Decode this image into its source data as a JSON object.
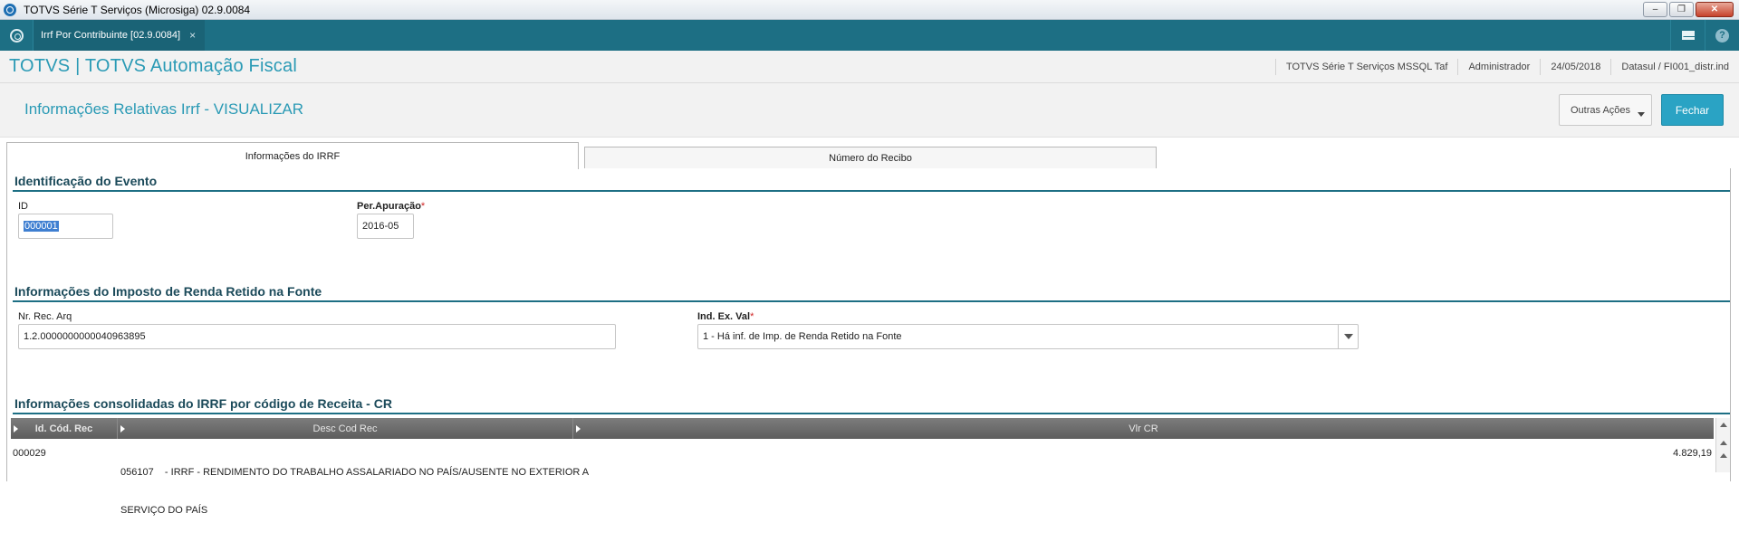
{
  "window": {
    "title": "TOTVS Série T Serviços (Microsiga) 02.9.0084",
    "minimize": "–",
    "restore": "❐",
    "close": "✕"
  },
  "tabbar": {
    "app_tab_label": "Irrf Por Contribuinte [02.9.0084]",
    "app_tab_close": "×",
    "help": "?"
  },
  "header": {
    "brand": "TOTVS | TOTVS Automação Fiscal",
    "info": [
      "TOTVS Série T Serviços MSSQL Taf",
      "Administrador",
      "24/05/2018",
      "Datasul / FI001_distr.ind"
    ]
  },
  "page": {
    "title": "Informações Relativas Irrf - VISUALIZAR",
    "outras_acoes": "Outras Ações",
    "fechar": "Fechar"
  },
  "tabs": [
    {
      "label": "Informações do IRRF",
      "active": true
    },
    {
      "label": "Número do Recibo",
      "active": false
    }
  ],
  "section1": {
    "title": "Identificação do Evento",
    "id_label": "ID",
    "id_value": "000001",
    "per_label": "Per.Apuração",
    "per_required": "*",
    "per_value": "2016-05"
  },
  "section2": {
    "title": "Informações do Imposto de Renda Retido na Fonte",
    "nr_label": "Nr. Rec. Arq",
    "nr_value": "1.2.0000000000040963895",
    "ind_label": "Ind. Ex. Val",
    "ind_required": "*",
    "ind_value": "1 - Há inf. de Imp. de Renda Retido na Fonte"
  },
  "section3": {
    "title": "Informações consolidadas do IRRF por código de Receita - CR",
    "columns": [
      "Id. Cód. Rec",
      "Desc Cod Rec",
      "Vlr CR"
    ],
    "rows": [
      {
        "id": "000029",
        "desc_line1": "056107    - IRRF - RENDIMENTO DO TRABALHO ASSALARIADO NO PAÍS/AUSENTE NO EXTERIOR A",
        "desc_line2": "SERVIÇO DO PAÍS",
        "vlr": "4.829,19"
      }
    ]
  }
}
